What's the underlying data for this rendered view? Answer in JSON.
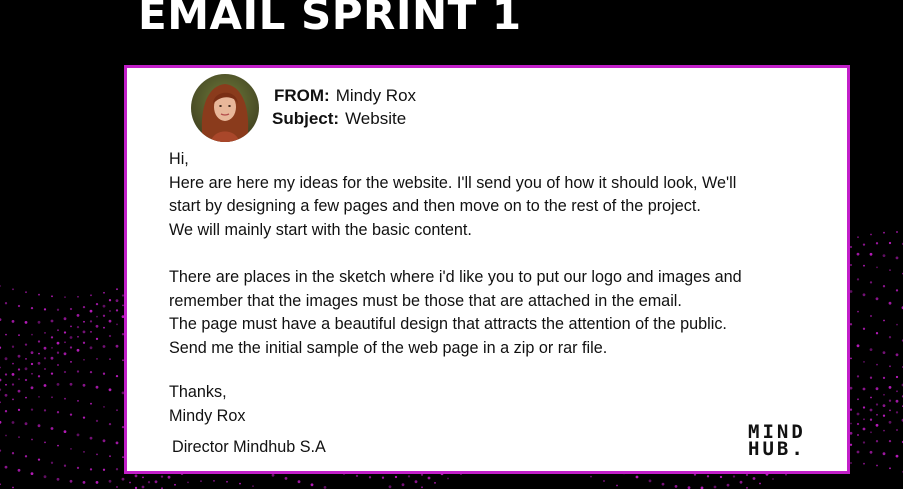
{
  "title": "EMAIL SPRINT 1",
  "email": {
    "from_label": "FROM:",
    "from_value": "Mindy Rox",
    "subject_label": "Subject:",
    "subject_value": "Website",
    "greeting": "Hi,",
    "para1": [
      "Here are here my ideas for the website. I'll send you of how it should look, We'll",
      "start by designing a few pages and then move on to the rest of the project.",
      "We will mainly start with the basic content."
    ],
    "para2": [
      "There are places in the sketch where i'd like you to put our logo and images and",
      "remember that the images must be those that are attached in the email.",
      "The page must have a beautiful design that attracts the attention of the public.",
      "Send me the initial sample of the web page in a zip or rar file."
    ],
    "closing": "Thanks,",
    "signature_name": "Mindy Rox",
    "signature_title": "Director Mindhub S.A"
  },
  "logo": {
    "line1": "MIND",
    "line2": "HUB."
  },
  "colors": {
    "accent": "#c21fc9",
    "background": "#000000",
    "card": "#ffffff"
  },
  "icons": {
    "avatar": "sender-avatar-photo"
  }
}
